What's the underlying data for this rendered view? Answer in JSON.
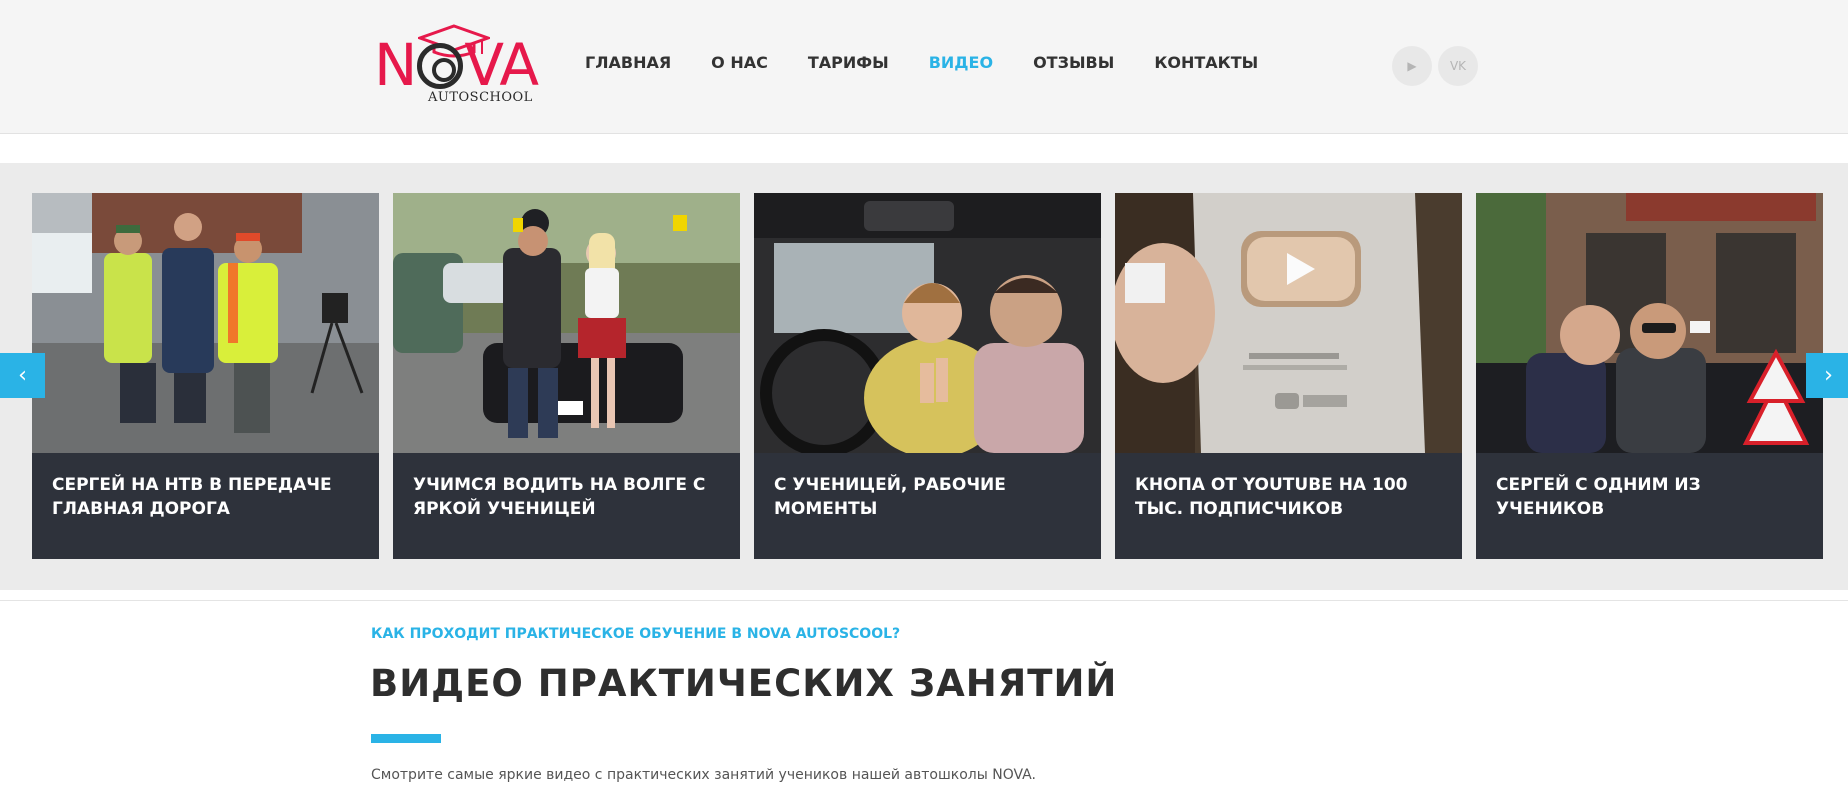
{
  "header": {
    "logo": {
      "word": "NOVA",
      "subtitle": "AUTOSCHOOL"
    },
    "nav": [
      {
        "label": "ГЛАВНАЯ",
        "active": false
      },
      {
        "label": "О НАС",
        "active": false
      },
      {
        "label": "ТАРИФЫ",
        "active": false
      },
      {
        "label": "ВИДЕО",
        "active": true
      },
      {
        "label": "ОТЗЫВЫ",
        "active": false
      },
      {
        "label": "КОНТАКТЫ",
        "active": false
      }
    ],
    "social": [
      {
        "icon": "youtube-icon",
        "glyph": "▶"
      },
      {
        "icon": "vk-icon",
        "glyph": "VK"
      }
    ]
  },
  "slider": {
    "prev_glyph": "‹",
    "next_glyph": "›",
    "cards": [
      {
        "title": "СЕРГЕЙ НА НТВ В ПЕРЕДАЧЕ ГЛАВНАЯ ДОРОГА"
      },
      {
        "title": "УЧИМСЯ ВОДИТЬ НА ВОЛГЕ С ЯРКОЙ УЧЕНИЦЕЙ"
      },
      {
        "title": "С УЧЕНИЦЕЙ, РАБОЧИЕ МОМЕНТЫ"
      },
      {
        "title": "КНОПА ОТ YOUTUBE НА 100 ТЫС. ПОДПИСЧИКОВ"
      },
      {
        "title": "СЕРГЕЙ С ОДНИМ ИЗ УЧЕНИКОВ"
      }
    ]
  },
  "section": {
    "kicker": "КАК ПРОХОДИТ ПРАКТИЧЕСКОЕ ОБУЧЕНИЕ В NOVA AUTOSCOOL?",
    "title": "ВИДЕО ПРАКТИЧЕСКИХ ЗАНЯТИЙ",
    "lead": "Смотрите самые яркие видео с практических занятий учеников нашей автошколы NOVA."
  },
  "colors": {
    "accent": "#2ab3e6",
    "brand_red": "#e6194b",
    "card_bg": "#2e323b",
    "header_bg": "#f5f5f5",
    "slider_bg": "#ebebeb"
  }
}
